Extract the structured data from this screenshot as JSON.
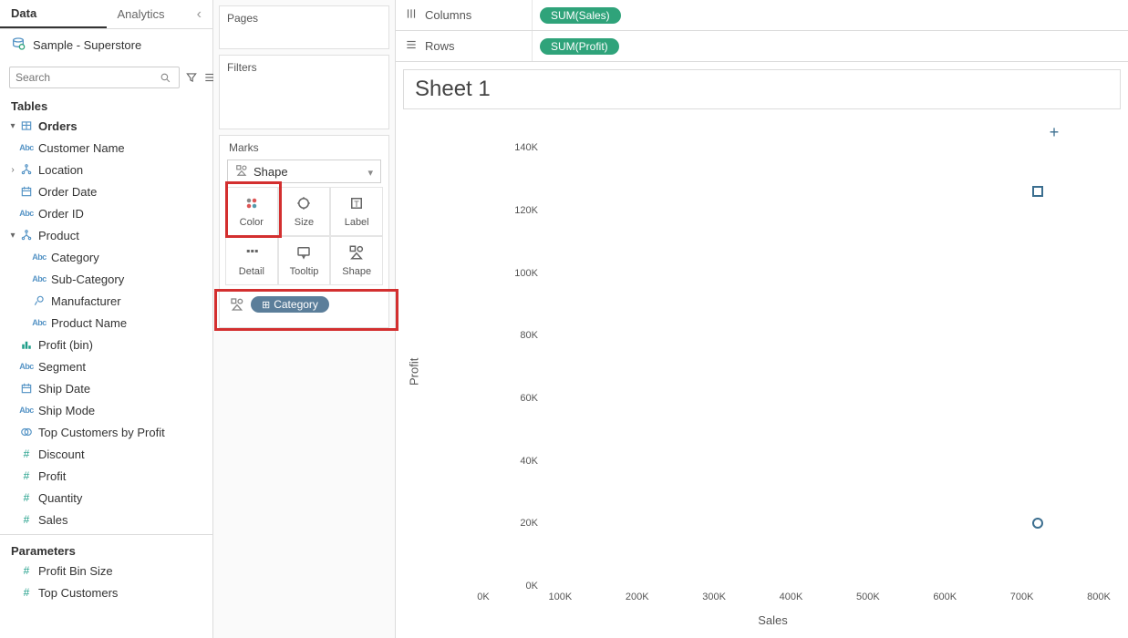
{
  "tabs": {
    "data": "Data",
    "analytics": "Analytics"
  },
  "datasource": "Sample - Superstore",
  "search": {
    "placeholder": "Search"
  },
  "tables_header": "Tables",
  "fields": {
    "orders": "Orders",
    "customer_name": "Customer Name",
    "location": "Location",
    "order_date": "Order Date",
    "order_id": "Order ID",
    "product": "Product",
    "category": "Category",
    "sub_category": "Sub-Category",
    "manufacturer": "Manufacturer",
    "product_name": "Product Name",
    "profit_bin": "Profit (bin)",
    "segment": "Segment",
    "ship_date": "Ship Date",
    "ship_mode": "Ship Mode",
    "top_customers": "Top Customers by Profit",
    "discount": "Discount",
    "profit": "Profit",
    "quantity": "Quantity",
    "sales": "Sales"
  },
  "parameters_header": "Parameters",
  "parameters": {
    "profit_bin_size": "Profit Bin Size",
    "top_customers": "Top Customers"
  },
  "cards": {
    "pages": "Pages",
    "filters": "Filters",
    "marks": "Marks",
    "mark_type": "Shape",
    "color": "Color",
    "size": "Size",
    "label": "Label",
    "detail": "Detail",
    "tooltip": "Tooltip",
    "shape": "Shape",
    "pill_category": "Category"
  },
  "shelves": {
    "columns": "Columns",
    "rows": "Rows",
    "col_pill": "SUM(Sales)",
    "row_pill": "SUM(Profit)"
  },
  "sheet_title": "Sheet 1",
  "chart_data": {
    "type": "scatter",
    "xlabel": "Sales",
    "ylabel": "Profit",
    "xlim": [
      0,
      800000
    ],
    "ylim": [
      0,
      150000
    ],
    "x_ticks": [
      "0K",
      "100K",
      "200K",
      "300K",
      "400K",
      "500K",
      "600K",
      "700K",
      "800K"
    ],
    "y_ticks": [
      "0K",
      "20K",
      "40K",
      "60K",
      "80K",
      "100K",
      "120K",
      "140K"
    ],
    "series": [
      {
        "name": "Category",
        "shape": "plus",
        "x": 742000,
        "y": 145000
      },
      {
        "name": "Category",
        "shape": "square",
        "x": 720000,
        "y": 126000
      },
      {
        "name": "Category",
        "shape": "circle",
        "x": 720000,
        "y": 20000
      }
    ]
  }
}
